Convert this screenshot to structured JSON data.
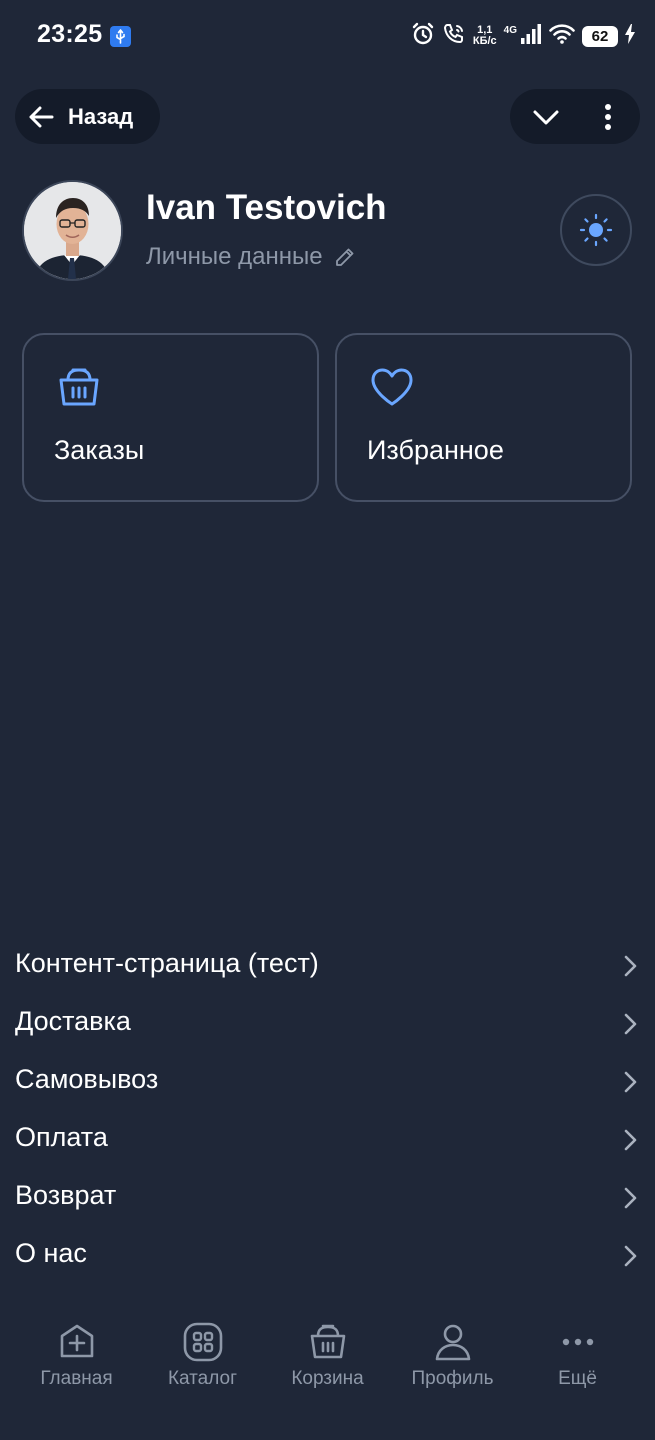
{
  "status_bar": {
    "time": "23:25",
    "net_speed_value": "1,1",
    "net_speed_unit": "КБ/с",
    "network_type": "4G",
    "battery": "62"
  },
  "header": {
    "back_label": "Назад"
  },
  "profile": {
    "name": "Ivan Testovich",
    "subtitle": "Личные данные"
  },
  "cards": [
    {
      "label": "Заказы",
      "icon": "basket-icon"
    },
    {
      "label": "Избранное",
      "icon": "heart-icon"
    }
  ],
  "links": [
    {
      "label": "Контент-страница (тест)"
    },
    {
      "label": "Доставка"
    },
    {
      "label": "Самовывоз"
    },
    {
      "label": "Оплата"
    },
    {
      "label": "Возврат"
    },
    {
      "label": "О нас"
    }
  ],
  "bottom_nav": [
    {
      "label": "Главная",
      "icon": "home-plus-icon"
    },
    {
      "label": "Каталог",
      "icon": "catalog-icon"
    },
    {
      "label": "Корзина",
      "icon": "basket-icon"
    },
    {
      "label": "Профиль",
      "icon": "user-icon"
    },
    {
      "label": "Ещё",
      "icon": "more-icon"
    }
  ],
  "colors": {
    "background": "#1f2738",
    "pill": "#141b29",
    "accent": "#6aa6ff",
    "muted_text": "#8e98a8",
    "card_border": "#465065"
  }
}
